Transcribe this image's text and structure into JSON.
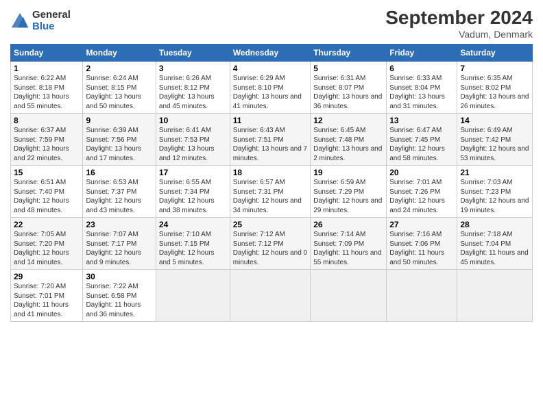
{
  "header": {
    "logo_general": "General",
    "logo_blue": "Blue",
    "title": "September 2024",
    "subtitle": "Vadum, Denmark"
  },
  "columns": [
    "Sunday",
    "Monday",
    "Tuesday",
    "Wednesday",
    "Thursday",
    "Friday",
    "Saturday"
  ],
  "weeks": [
    [
      {
        "day": "1",
        "sunrise": "6:22 AM",
        "sunset": "8:18 PM",
        "daylight": "13 hours and 55 minutes."
      },
      {
        "day": "2",
        "sunrise": "6:24 AM",
        "sunset": "8:15 PM",
        "daylight": "13 hours and 50 minutes."
      },
      {
        "day": "3",
        "sunrise": "6:26 AM",
        "sunset": "8:12 PM",
        "daylight": "13 hours and 45 minutes."
      },
      {
        "day": "4",
        "sunrise": "6:29 AM",
        "sunset": "8:10 PM",
        "daylight": "13 hours and 41 minutes."
      },
      {
        "day": "5",
        "sunrise": "6:31 AM",
        "sunset": "8:07 PM",
        "daylight": "13 hours and 36 minutes."
      },
      {
        "day": "6",
        "sunrise": "6:33 AM",
        "sunset": "8:04 PM",
        "daylight": "13 hours and 31 minutes."
      },
      {
        "day": "7",
        "sunrise": "6:35 AM",
        "sunset": "8:02 PM",
        "daylight": "13 hours and 26 minutes."
      }
    ],
    [
      {
        "day": "8",
        "sunrise": "6:37 AM",
        "sunset": "7:59 PM",
        "daylight": "13 hours and 22 minutes."
      },
      {
        "day": "9",
        "sunrise": "6:39 AM",
        "sunset": "7:56 PM",
        "daylight": "13 hours and 17 minutes."
      },
      {
        "day": "10",
        "sunrise": "6:41 AM",
        "sunset": "7:53 PM",
        "daylight": "13 hours and 12 minutes."
      },
      {
        "day": "11",
        "sunrise": "6:43 AM",
        "sunset": "7:51 PM",
        "daylight": "13 hours and 7 minutes."
      },
      {
        "day": "12",
        "sunrise": "6:45 AM",
        "sunset": "7:48 PM",
        "daylight": "13 hours and 2 minutes."
      },
      {
        "day": "13",
        "sunrise": "6:47 AM",
        "sunset": "7:45 PM",
        "daylight": "12 hours and 58 minutes."
      },
      {
        "day": "14",
        "sunrise": "6:49 AM",
        "sunset": "7:42 PM",
        "daylight": "12 hours and 53 minutes."
      }
    ],
    [
      {
        "day": "15",
        "sunrise": "6:51 AM",
        "sunset": "7:40 PM",
        "daylight": "12 hours and 48 minutes."
      },
      {
        "day": "16",
        "sunrise": "6:53 AM",
        "sunset": "7:37 PM",
        "daylight": "12 hours and 43 minutes."
      },
      {
        "day": "17",
        "sunrise": "6:55 AM",
        "sunset": "7:34 PM",
        "daylight": "12 hours and 38 minutes."
      },
      {
        "day": "18",
        "sunrise": "6:57 AM",
        "sunset": "7:31 PM",
        "daylight": "12 hours and 34 minutes."
      },
      {
        "day": "19",
        "sunrise": "6:59 AM",
        "sunset": "7:29 PM",
        "daylight": "12 hours and 29 minutes."
      },
      {
        "day": "20",
        "sunrise": "7:01 AM",
        "sunset": "7:26 PM",
        "daylight": "12 hours and 24 minutes."
      },
      {
        "day": "21",
        "sunrise": "7:03 AM",
        "sunset": "7:23 PM",
        "daylight": "12 hours and 19 minutes."
      }
    ],
    [
      {
        "day": "22",
        "sunrise": "7:05 AM",
        "sunset": "7:20 PM",
        "daylight": "12 hours and 14 minutes."
      },
      {
        "day": "23",
        "sunrise": "7:07 AM",
        "sunset": "7:17 PM",
        "daylight": "12 hours and 9 minutes."
      },
      {
        "day": "24",
        "sunrise": "7:10 AM",
        "sunset": "7:15 PM",
        "daylight": "12 hours and 5 minutes."
      },
      {
        "day": "25",
        "sunrise": "7:12 AM",
        "sunset": "7:12 PM",
        "daylight": "12 hours and 0 minutes."
      },
      {
        "day": "26",
        "sunrise": "7:14 AM",
        "sunset": "7:09 PM",
        "daylight": "11 hours and 55 minutes."
      },
      {
        "day": "27",
        "sunrise": "7:16 AM",
        "sunset": "7:06 PM",
        "daylight": "11 hours and 50 minutes."
      },
      {
        "day": "28",
        "sunrise": "7:18 AM",
        "sunset": "7:04 PM",
        "daylight": "11 hours and 45 minutes."
      }
    ],
    [
      {
        "day": "29",
        "sunrise": "7:20 AM",
        "sunset": "7:01 PM",
        "daylight": "11 hours and 41 minutes."
      },
      {
        "day": "30",
        "sunrise": "7:22 AM",
        "sunset": "6:58 PM",
        "daylight": "11 hours and 36 minutes."
      },
      null,
      null,
      null,
      null,
      null
    ]
  ]
}
